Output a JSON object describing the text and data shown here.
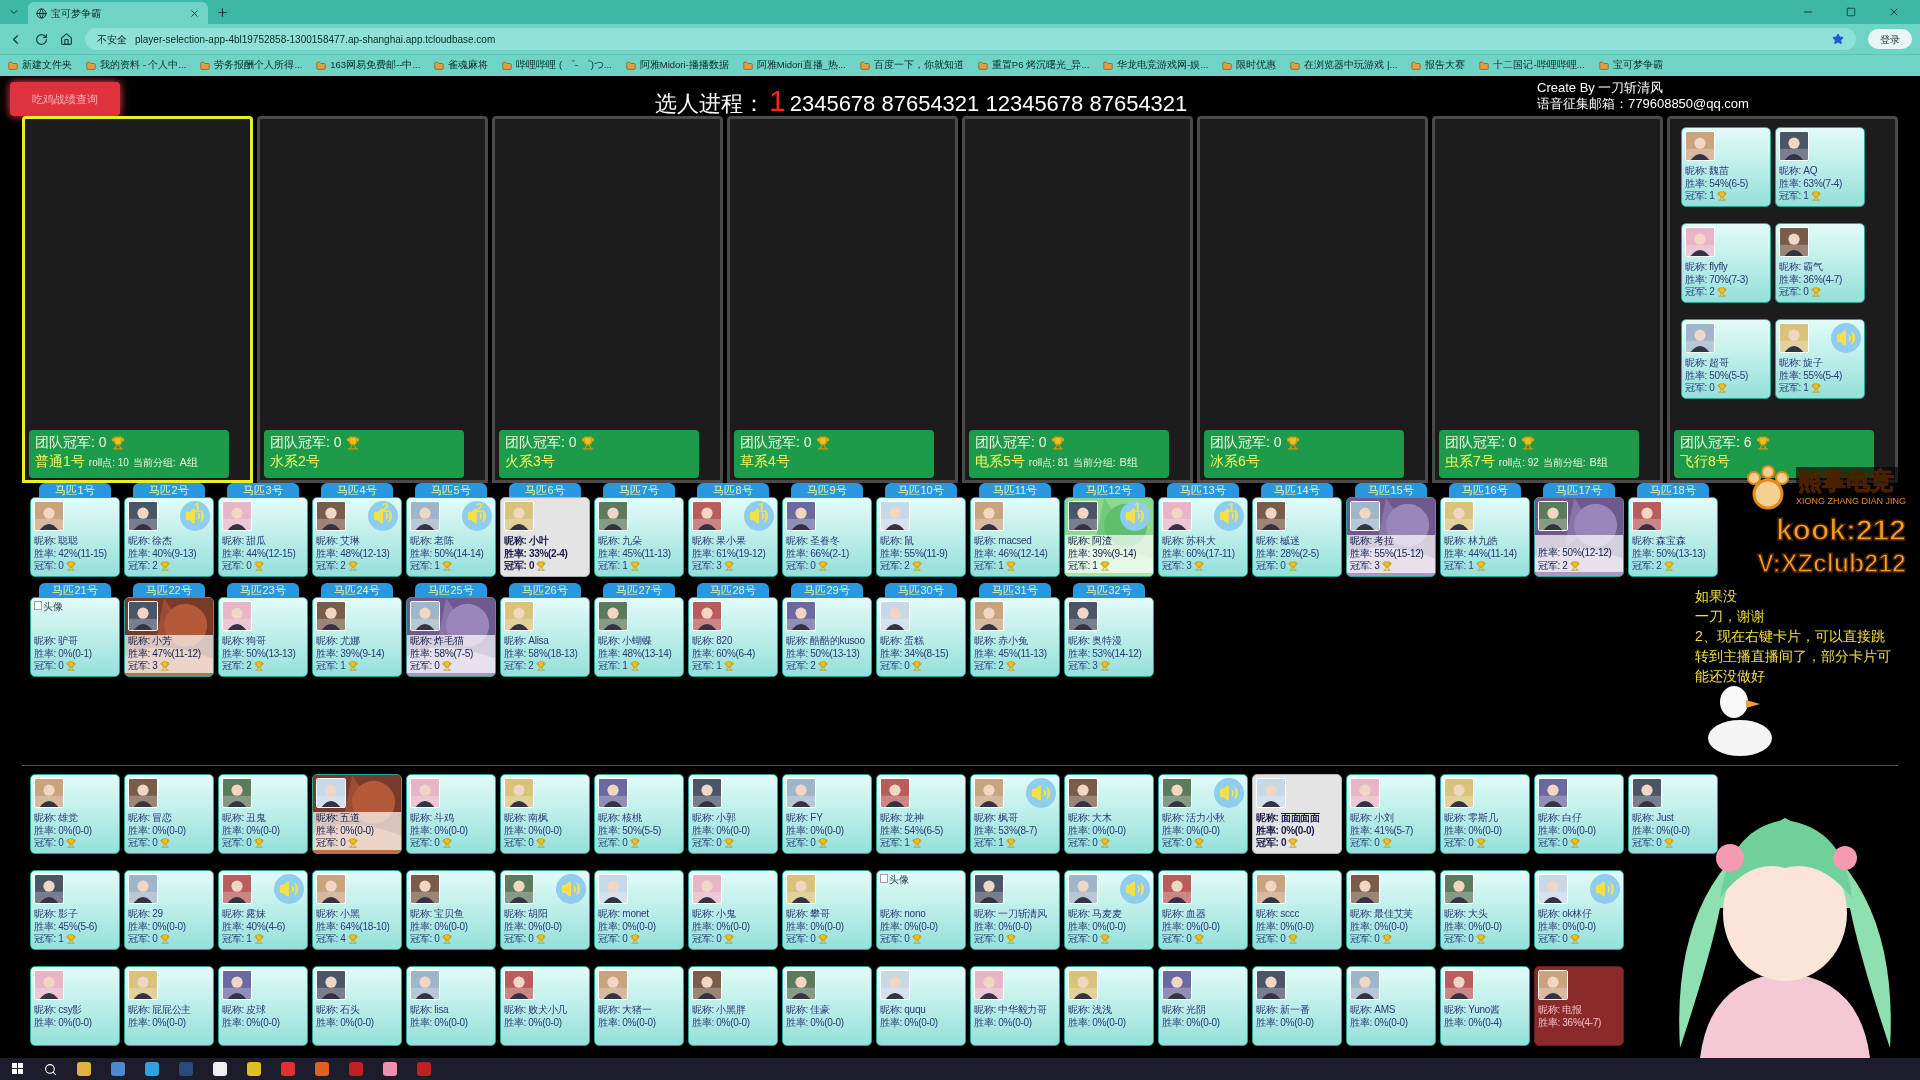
{
  "browser": {
    "tab": "宝可梦争霸",
    "insecure": "不安全",
    "url": "player-selection-app-4bl19752858-1300158477.ap-shanghai.app.tcloudbase.com",
    "login": "登录",
    "bookmarks": [
      "新建文件夹",
      "我的资料 - 个人中...",
      "劳务报酬个人所得...",
      "163网易免费邮--中...",
      "雀魂麻将",
      "哔哩哔哩 ( ゜- ゜)つ...",
      "阿雅Midori-播播数据",
      "阿雅Midori直播_热...",
      "百度一下，你就知道",
      "重置P6 烤沉曙光_异...",
      "华龙电竞游戏网-娱...",
      "限时优惠",
      "在浏览器中玩游戏 |...",
      "报告大赛",
      "十二国记-哔哩哔哩...",
      "宝可梦争霸"
    ]
  },
  "header": {
    "query_button": "吃鸡战绩查询",
    "title": "选人进程：",
    "current": "1",
    "sequence": "2345678 87654321 12345678 87654321",
    "credits": [
      "Create By 一刀斩清风",
      "语音征集邮箱：779608850@qq.com"
    ]
  },
  "teams": [
    {
      "selected": true,
      "champ": "团队冠军: 0",
      "name": "普通1号",
      "roll": "roll点: 10",
      "group_label": "当前分组:",
      "group": "A组"
    },
    {
      "selected": false,
      "champ": "团队冠军: 0",
      "name": "水系2号"
    },
    {
      "selected": false,
      "champ": "团队冠军: 0",
      "name": "火系3号"
    },
    {
      "selected": false,
      "champ": "团队冠军: 0",
      "name": "草系4号"
    },
    {
      "selected": false,
      "champ": "团队冠军: 0",
      "name": "电系5号",
      "roll": "roll点: 81",
      "group_label": "当前分组:",
      "group": "B组"
    },
    {
      "selected": false,
      "champ": "团队冠军: 0",
      "name": "冰系6号"
    },
    {
      "selected": false,
      "champ": "团队冠军: 0",
      "name": "虫系7号",
      "roll": "roll点: 92",
      "group_label": "当前分组:",
      "group": "B组"
    },
    {
      "selected": false,
      "champ": "团队冠军: 6",
      "name": "飞行8号",
      "members": [
        {
          "kind": "plain",
          "name": "昵称: 魏苗",
          "rate": "胜率: 54%(6-5)",
          "champ": "冠军: 1",
          "speaker": false
        },
        {
          "kind": "plain",
          "name": "昵称: AQ",
          "rate": "胜率: 63%(7-4)",
          "champ": "冠军: 1",
          "speaker": false
        },
        {
          "kind": "plain",
          "name": "昵称: flyfly",
          "rate": "胜率: 70%(7-3)",
          "champ": "冠军: 2",
          "speaker": false
        },
        {
          "kind": "plain",
          "name": "昵称: 霸气",
          "rate": "胜率: 36%(4-7)",
          "champ": "冠军: 0",
          "speaker": false
        },
        {
          "kind": "plain",
          "name": "昵称: 超哥",
          "rate": "胜率: 50%(5-5)",
          "champ": "冠军: 0",
          "speaker": false
        },
        {
          "kind": "plain",
          "name": "昵称: 旋子",
          "rate": "胜率: 55%(5-4)",
          "champ": "冠军: 1",
          "speaker": true
        }
      ]
    }
  ],
  "horses": [
    [
      {
        "label": "马匹1号",
        "kind": "plain",
        "name": "昵称: 聪聪",
        "rate": "胜率: 42%(11-15)",
        "champ": "冠军: 0",
        "speaker": false
      },
      {
        "label": "马匹2号",
        "kind": "plain",
        "name": "昵称: 徐杰",
        "rate": "胜率: 40%(9-13)",
        "champ": "冠军: 2",
        "speaker": true,
        "speaker_count": "1"
      },
      {
        "label": "马匹3号",
        "kind": "plain",
        "name": "昵称: 甜瓜",
        "rate": "胜率: 44%(12-15)",
        "champ": "冠军: 0",
        "speaker": false
      },
      {
        "label": "马匹4号",
        "kind": "plain",
        "name": "昵称: 艾琳",
        "rate": "胜率: 48%(12-13)",
        "champ": "冠军: 2",
        "speaker": true,
        "speaker_count": "2"
      },
      {
        "label": "马匹5号",
        "kind": "plain",
        "name": "昵称: 老陈",
        "rate": "胜率: 50%(14-14)",
        "champ": "冠军: 1",
        "speaker": true,
        "speaker_count": "2"
      },
      {
        "label": "马匹6号",
        "kind": "grey",
        "name": "昵称: 小叶",
        "rate": "胜率: 33%(2-4)",
        "champ": "冠军: 0",
        "speaker": false
      },
      {
        "label": "马匹7号",
        "kind": "plain",
        "name": "昵称: 九朵",
        "rate": "胜率: 45%(11-13)",
        "champ": "冠军: 1",
        "speaker": false
      },
      {
        "label": "马匹8号",
        "kind": "plain",
        "name": "昵称: 果小果",
        "rate": "胜率: 61%(19-12)",
        "champ": "冠军: 3",
        "speaker": true,
        "speaker_count": "1"
      },
      {
        "label": "马匹9号",
        "kind": "plain",
        "name": "昵称: 圣眷冬",
        "rate": "胜率: 66%(2-1)",
        "champ": "冠军: 0",
        "speaker": false
      },
      {
        "label": "马匹10号",
        "kind": "plain",
        "name": "昵称: 鼠",
        "rate": "胜率: 55%(11-9)",
        "champ": "冠军: 2",
        "speaker": false
      },
      {
        "label": "马匹11号",
        "kind": "plain",
        "name": "昵称: macsed",
        "rate": "胜率: 46%(12-14)",
        "champ": "冠军: 1",
        "speaker": false
      },
      {
        "label": "马匹12号",
        "kind": "green",
        "name": "昵称: 阿渣",
        "rate": "胜率: 39%(9-14)",
        "champ": "冠军: 1",
        "speaker": true,
        "speaker_count": "1"
      },
      {
        "label": "马匹13号",
        "kind": "plain",
        "name": "昵称: 苏科大",
        "rate": "胜率: 60%(17-11)",
        "champ": "冠军: 3",
        "speaker": true,
        "speaker_count": "1"
      },
      {
        "label": "马匹14号",
        "kind": "plain",
        "name": "昵称: 槭迷",
        "rate": "胜率: 28%(2-5)",
        "champ": "冠军: 0",
        "speaker": false
      },
      {
        "label": "马匹15号",
        "kind": "picture",
        "name": "昵称: 考拉",
        "rate": "胜率: 55%(15-12)",
        "champ": "冠军: 3",
        "speaker": false
      },
      {
        "label": "马匹16号",
        "kind": "plain",
        "name": "昵称: 林九皓",
        "rate": "胜率: 44%(11-14)",
        "champ": "冠军: 1",
        "speaker": false
      },
      {
        "label": "马匹17号",
        "kind": "picture",
        "rate": "胜率: 50%(12-12)",
        "champ": "冠军: 2",
        "speaker": false
      },
      {
        "label": "马匹18号",
        "kind": "plain",
        "name": "昵称: 森宝森",
        "rate": "胜率: 50%(13-13)",
        "champ": "冠军: 2",
        "speaker": false
      }
    ],
    [
      {
        "label": "马匹21号",
        "kind": "plain",
        "avatar_alt": "头像",
        "name": "昵称: 驴哥",
        "rate": "胜率: 0%(0-1)",
        "champ": "冠军: 0",
        "speaker": false
      },
      {
        "label": "马匹22号",
        "kind": "picture",
        "name": "昵称: 小芳",
        "rate": "胜率: 47%(11-12)",
        "champ": "冠军: 3",
        "speaker": false
      },
      {
        "label": "马匹23号",
        "kind": "plain",
        "name": "昵称: 狗哥",
        "rate": "胜率: 50%(13-13)",
        "champ": "冠军: 2",
        "speaker": false
      },
      {
        "label": "马匹24号",
        "kind": "plain",
        "name": "昵称: 尤娜",
        "rate": "胜率: 39%(9-14)",
        "champ": "冠军: 1",
        "speaker": false
      },
      {
        "label": "马匹25号",
        "kind": "picture",
        "name": "昵称: 炸毛猫",
        "rate": "胜率: 58%(7-5)",
        "champ": "冠军: 0",
        "speaker": false
      },
      {
        "label": "马匹26号",
        "kind": "plain",
        "name": "昵称: Alisa",
        "rate": "胜率: 58%(18-13)",
        "champ": "冠军: 2",
        "speaker": false
      },
      {
        "label": "马匹27号",
        "kind": "plain",
        "name": "昵称: 小蝴蝶",
        "rate": "胜率: 48%(13-14)",
        "champ": "冠军: 1",
        "speaker": false
      },
      {
        "label": "马匹28号",
        "kind": "plain",
        "name": "昵称: 820",
        "rate": "胜率: 60%(6-4)",
        "champ": "冠军: 1",
        "speaker": false
      },
      {
        "label": "马匹29号",
        "kind": "plain",
        "name": "昵称: 酷酷的kusoo",
        "rate": "胜率: 50%(13-13)",
        "champ": "冠军: 2",
        "speaker": false
      },
      {
        "label": "马匹30号",
        "kind": "plain",
        "name": "昵称: 蛋糕",
        "rate": "胜率: 34%(8-15)",
        "champ": "冠军: 0",
        "speaker": false
      },
      {
        "label": "马匹31号",
        "kind": "plain",
        "name": "昵称: 赤小兔",
        "rate": "胜率: 45%(11-13)",
        "champ": "冠军: 2",
        "speaker": false
      },
      {
        "label": "马匹32号",
        "kind": "plain",
        "name": "昵称: 奥特漫",
        "rate": "胜率: 53%(14-12)",
        "champ": "冠军: 3",
        "speaker": false
      }
    ]
  ],
  "pool": [
    [
      {
        "kind": "plain",
        "name": "昵称: 雄党",
        "rate": "胜率: 0%(0-0)",
        "champ": "冠军: 0",
        "speaker": false
      },
      {
        "kind": "plain",
        "name": "昵称: 冒恋",
        "rate": "胜率: 0%(0-0)",
        "champ": "冠军: 0",
        "speaker": false
      },
      {
        "kind": "plain",
        "name": "昵称: 丑鬼",
        "rate": "胜率: 0%(0-0)",
        "champ": "冠军: 0",
        "speaker": false
      },
      {
        "kind": "picture",
        "name": "昵称: 五道",
        "rate": "胜率: 0%(0-0)",
        "champ": "冠军: 0",
        "speaker": false
      },
      {
        "kind": "plain",
        "name": "昵称: 斗鸡",
        "rate": "胜率: 0%(0-0)",
        "champ": "冠军: 0",
        "speaker": false
      },
      {
        "kind": "plain",
        "name": "昵称: 南枫",
        "rate": "胜率: 0%(0-0)",
        "champ": "冠军: 0",
        "speaker": false
      },
      {
        "kind": "plain",
        "name": "昵称: 核桃",
        "rate": "胜率: 50%(5-5)",
        "champ": "冠军: 0",
        "speaker": false
      },
      {
        "kind": "plain",
        "name": "昵称: 小郭",
        "rate": "胜率: 0%(0-0)",
        "champ": "冠军: 0",
        "speaker": false
      },
      {
        "kind": "plain",
        "name": "昵称: FY",
        "rate": "胜率: 0%(0-0)",
        "champ": "冠军: 0",
        "speaker": false
      },
      {
        "kind": "plain",
        "name": "昵称: 龙神",
        "rate": "胜率: 54%(6-5)",
        "champ": "冠军: 1",
        "speaker": false
      },
      {
        "kind": "plain",
        "name": "昵称: 枫哥",
        "rate": "胜率: 53%(8-7)",
        "champ": "冠军: 1",
        "speaker": true
      },
      {
        "kind": "plain",
        "name": "昵称: 大木",
        "rate": "胜率: 0%(0-0)",
        "champ": "冠军: 0",
        "speaker": false
      },
      {
        "kind": "plain",
        "name": "昵称: 活力小秋",
        "rate": "胜率: 0%(0-0)",
        "champ": "冠军: 0",
        "speaker": true
      },
      {
        "kind": "grey",
        "name": "昵称: 面面面面",
        "rate": "胜率: 0%(0-0)",
        "champ": "冠军: 0",
        "speaker": false
      },
      {
        "kind": "plain",
        "name": "昵称: 小刘",
        "rate": "胜率: 41%(5-7)",
        "champ": "冠军: 0",
        "speaker": false
      },
      {
        "kind": "plain",
        "name": "昵称: 零斯几",
        "rate": "胜率: 0%(0-0)",
        "champ": "冠军: 0",
        "speaker": false
      },
      {
        "kind": "plain",
        "name": "昵称: 白仔",
        "rate": "胜率: 0%(0-0)",
        "champ": "冠军: 0",
        "speaker": false
      },
      {
        "kind": "plain",
        "name": "昵称: Just",
        "rate": "胜率: 0%(0-0)",
        "champ": "冠军: 0",
        "speaker": false
      }
    ],
    [
      {
        "kind": "plain",
        "name": "昵称: 影子",
        "rate": "胜率: 45%(5-6)",
        "champ": "冠军: 1",
        "speaker": false
      },
      {
        "kind": "plain",
        "name": "昵称: 29",
        "rate": "胜率: 0%(0-0)",
        "champ": "冠军: 0",
        "speaker": false
      },
      {
        "kind": "plain",
        "name": "昵称: 露妹",
        "rate": "胜率: 40%(4-6)",
        "champ": "冠军: 1",
        "speaker": true
      },
      {
        "kind": "plain",
        "name": "昵称: 小黑",
        "rate": "胜率: 64%(18-10)",
        "champ": "冠军: 4",
        "speaker": false
      },
      {
        "kind": "plain",
        "name": "昵称: 宝贝鱼",
        "rate": "胜率: 0%(0-0)",
        "champ": "冠军: 0",
        "speaker": false
      },
      {
        "kind": "plain",
        "name": "昵称: 胡阳",
        "rate": "胜率: 0%(0-0)",
        "champ": "冠军: 0",
        "speaker": true
      },
      {
        "kind": "plain",
        "name": "昵称: monet",
        "rate": "胜率: 0%(0-0)",
        "champ": "冠军: 0",
        "speaker": false
      },
      {
        "kind": "plain",
        "name": "昵称: 小鬼",
        "rate": "胜率: 0%(0-0)",
        "champ": "冠军: 0",
        "speaker": false
      },
      {
        "kind": "plain",
        "name": "昵称: 攀哥",
        "rate": "胜率: 0%(0-0)",
        "champ": "冠军: 0",
        "speaker": false
      },
      {
        "kind": "plain",
        "avatar_alt": "头像",
        "name": "昵称: nono",
        "rate": "胜率: 0%(0-0)",
        "champ": "冠军: 0",
        "speaker": false
      },
      {
        "kind": "plain",
        "name": "昵称: 一刀斩清风",
        "rate": "胜率: 0%(0-0)",
        "champ": "冠军: 0",
        "speaker": false
      },
      {
        "kind": "plain",
        "name": "昵称: 马麦麦",
        "rate": "胜率: 0%(0-0)",
        "champ": "冠军: 0",
        "speaker": true
      },
      {
        "kind": "plain",
        "name": "昵称: 血器",
        "rate": "胜率: 0%(0-0)",
        "champ": "冠军: 0",
        "speaker": false
      },
      {
        "kind": "plain",
        "name": "昵称: sccc",
        "rate": "胜率: 0%(0-0)",
        "champ": "冠军: 0",
        "speaker": false
      },
      {
        "kind": "plain",
        "name": "昵称: 最佳艾芙",
        "rate": "胜率: 0%(0-0)",
        "champ": "冠军: 0",
        "speaker": false
      },
      {
        "kind": "plain",
        "name": "昵称: 大头",
        "rate": "胜率: 0%(0-0)",
        "champ": "冠军: 0",
        "speaker": false
      },
      {
        "kind": "plain",
        "name": "昵称: ok林仔",
        "rate": "胜率: 0%(0-0)",
        "champ": "冠军: 0",
        "speaker": true
      }
    ],
    [
      {
        "kind": "plain",
        "name": "昵称: csy影",
        "rate": "胜率: 0%(0-0)",
        "speaker": false
      },
      {
        "kind": "plain",
        "name": "昵称: 屁屁公主",
        "rate": "胜率: 0%(0-0)",
        "speaker": false
      },
      {
        "kind": "plain",
        "name": "昵称: 皮球",
        "rate": "胜率: 0%(0-0)",
        "speaker": false
      },
      {
        "kind": "plain",
        "name": "昵称: 石头",
        "rate": "胜率: 0%(0-0)",
        "speaker": false
      },
      {
        "kind": "plain",
        "name": "昵称: lisa",
        "rate": "胜率: 0%(0-0)",
        "speaker": false
      },
      {
        "kind": "plain",
        "name": "昵称: 败犬小几",
        "rate": "胜率: 0%(0-0)",
        "speaker": false
      },
      {
        "kind": "plain",
        "name": "昵称: 大猪一",
        "rate": "胜率: 0%(0-0)",
        "speaker": false
      },
      {
        "kind": "plain",
        "name": "昵称: 小黑胖",
        "rate": "胜率: 0%(0-0)",
        "speaker": false
      },
      {
        "kind": "plain",
        "name": "昵称: 佳豪",
        "rate": "胜率: 0%(0-0)",
        "speaker": false
      },
      {
        "kind": "plain",
        "name": "昵称: ququ",
        "rate": "胜率: 0%(0-0)",
        "speaker": false
      },
      {
        "kind": "plain",
        "name": "昵称: 中华毅力哥",
        "rate": "胜率: 0%(0-0)",
        "speaker": false
      },
      {
        "kind": "plain",
        "name": "昵称: 浅浅",
        "rate": "胜率: 0%(0-0)",
        "speaker": false
      },
      {
        "kind": "plain",
        "name": "昵称: 光阴",
        "rate": "胜率: 0%(0-0)",
        "speaker": false
      },
      {
        "kind": "plain",
        "name": "昵称: 新一番",
        "rate": "胜率: 0%(0-0)",
        "speaker": false
      },
      {
        "kind": "plain",
        "name": "昵称: AMS",
        "rate": "胜率: 0%(0-0)",
        "speaker": false
      },
      {
        "kind": "plain",
        "name": "昵称: Yuno酱",
        "rate": "胜率: 0%(0-4)",
        "speaker": false
      },
      {
        "kind": "red",
        "name": "昵称: 电报",
        "rate": "胜率: 36%(4-7)",
        "speaker": false
      }
    ]
  ],
  "overlay": {
    "brand": "熊掌电竞",
    "brand_latin": "XIONG ZHANG DIAN JING",
    "kook": "kook:212",
    "wechat": "V:XZclub212",
    "notice": [
      "如果没",
      "一刀，谢谢",
      "2、现在右键卡片，可以直接跳转到主播直播间了，部分卡片可能还没做好"
    ]
  }
}
